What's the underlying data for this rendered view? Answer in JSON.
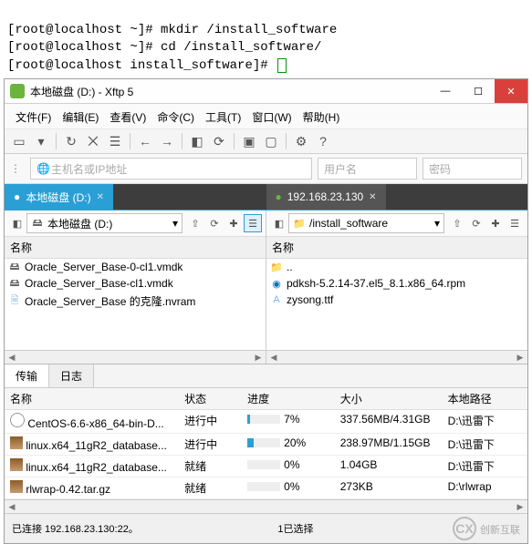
{
  "terminal": {
    "line1": "[root@localhost ~]# mkdir /install_software",
    "line2": "[root@localhost ~]# cd /install_software/",
    "line3": "[root@localhost install_software]# "
  },
  "window": {
    "title": "本地磁盘 (D:)   - Xftp 5"
  },
  "menu": {
    "file": "文件(F)",
    "edit": "编辑(E)",
    "view": "查看(V)",
    "commands": "命令(C)",
    "tools": "工具(T)",
    "window": "窗口(W)",
    "help": "帮助(H)"
  },
  "address": {
    "host_placeholder": "主机名或IP地址",
    "user_placeholder": "用户名",
    "pass_placeholder": "密码"
  },
  "tabs": {
    "left": "本地磁盘 (D:)",
    "right": "192.168.23.130"
  },
  "pane_left": {
    "path": "本地磁盘 (D:)",
    "col_name": "名称",
    "files": [
      "Oracle_Server_Base-0-cl1.vmdk",
      "Oracle_Server_Base-cl1.vmdk",
      "Oracle_Server_Base 的克隆.nvram"
    ]
  },
  "pane_right": {
    "path": "/install_software",
    "col_name": "名称",
    "up": "..",
    "files": [
      "pdksh-5.2.14-37.el5_8.1.x86_64.rpm",
      "zysong.ttf"
    ]
  },
  "transfer": {
    "tab_transfer": "传输",
    "tab_log": "日志",
    "col_name": "名称",
    "col_status": "状态",
    "col_progress": "进度",
    "col_size": "大小",
    "col_path": "本地路径",
    "rows": [
      {
        "name": "CentOS-6.6-x86_64-bin-D...",
        "status": "进行中",
        "progress": 7,
        "progress_label": "7%",
        "size": "337.56MB/4.31GB",
        "path": "D:\\迅雷下"
      },
      {
        "name": "linux.x64_11gR2_database...",
        "status": "进行中",
        "progress": 20,
        "progress_label": "20%",
        "size": "238.97MB/1.15GB",
        "path": "D:\\迅雷下"
      },
      {
        "name": "linux.x64_11gR2_database...",
        "status": "就绪",
        "progress": 0,
        "progress_label": "0%",
        "size": "1.04GB",
        "path": "D:\\迅雷下"
      },
      {
        "name": "rlwrap-0.42.tar.gz",
        "status": "就绪",
        "progress": 0,
        "progress_label": "0%",
        "size": "273KB",
        "path": "D:\\rlwrap"
      }
    ]
  },
  "status": {
    "left": "已连接 192.168.23.130:22。",
    "right": "1已选择"
  },
  "watermark": "创新互联"
}
